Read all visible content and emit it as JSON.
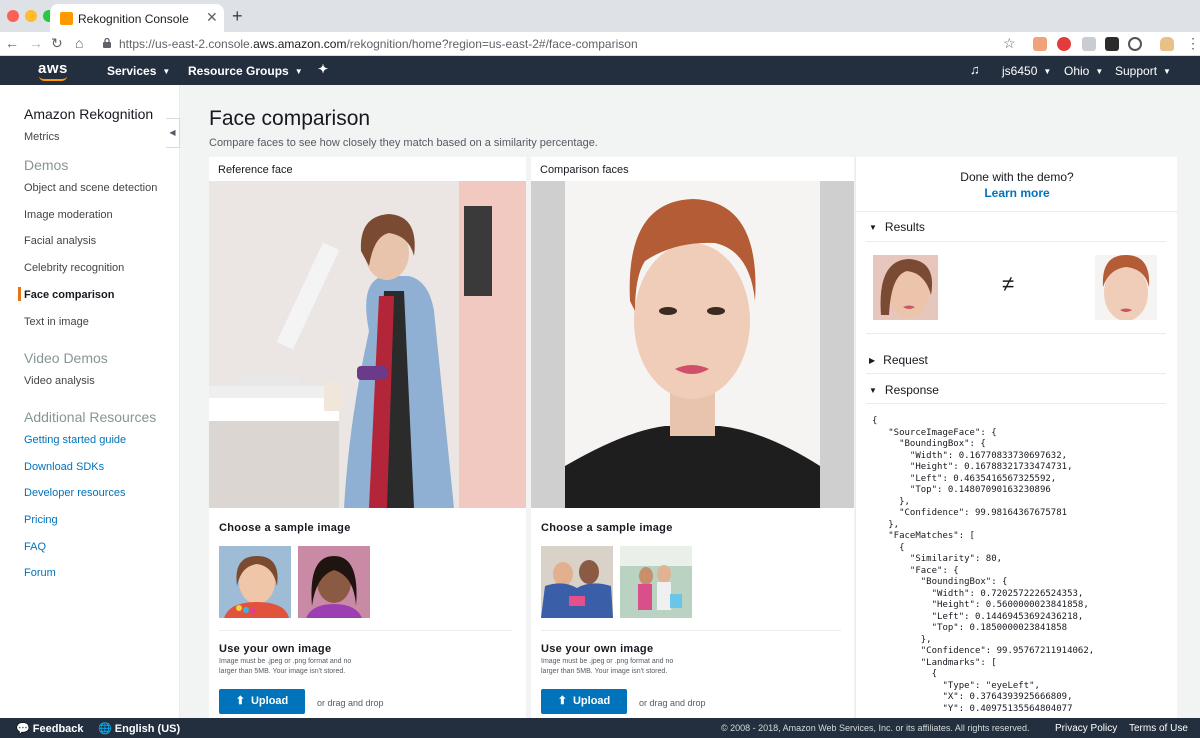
{
  "browser": {
    "tab_title": "Rekognition Console",
    "url_prefix": "https://us-east-2.console.",
    "url_domain": "aws.amazon.com",
    "url_path": "/rekognition/home?region=us-east-2#/face-comparison"
  },
  "topnav": {
    "logo": "aws",
    "services": "Services",
    "resource_groups": "Resource Groups",
    "user": "js6450",
    "region": "Ohio",
    "support": "Support"
  },
  "sidebar": {
    "title": "Amazon Rekognition",
    "metrics": "Metrics",
    "demos_heading": "Demos",
    "demos": [
      "Object and scene detection",
      "Image moderation",
      "Facial analysis",
      "Celebrity recognition",
      "Face comparison",
      "Text in image"
    ],
    "video_heading": "Video Demos",
    "video": [
      "Video analysis"
    ],
    "resources_heading": "Additional Resources",
    "resources": [
      "Getting started guide",
      "Download SDKs",
      "Developer resources",
      "Pricing",
      "FAQ",
      "Forum"
    ]
  },
  "main": {
    "title": "Face comparison",
    "subtitle": "Compare faces to see how closely they match based on a similarity percentage.",
    "reference": {
      "label": "Reference face",
      "sample_heading": "Choose a sample image",
      "own_heading": "Use your own image",
      "hint": "Image must be .jpeg or .png format and no larger than 5MB. Your image isn't stored.",
      "upload": "Upload",
      "dnd": "or drag and drop"
    },
    "comparison": {
      "label": "Comparison faces",
      "sample_heading": "Choose a sample image",
      "own_heading": "Use your own image",
      "hint": "Image must be .jpeg or .png format and no larger than 5MB. Your image isn't stored.",
      "upload": "Upload",
      "dnd": "or drag and drop"
    }
  },
  "right": {
    "done": "Done with the demo?",
    "learn_more": "Learn more",
    "results": "Results",
    "not_equal": "≠",
    "request": "Request",
    "response": "Response",
    "json": "{\n   \"SourceImageFace\": {\n     \"BoundingBox\": {\n       \"Width\": 0.16770833730697632,\n       \"Height\": 0.16788321733474731,\n       \"Left\": 0.4635416567325592,\n       \"Top\": 0.14807090163230896\n     },\n     \"Confidence\": 99.98164367675781\n   },\n   \"FaceMatches\": [\n     {\n       \"Similarity\": 80,\n       \"Face\": {\n         \"BoundingBox\": {\n           \"Width\": 0.7202572226524353,\n           \"Height\": 0.5600000023841858,\n           \"Left\": 0.14469453692436218,\n           \"Top\": 0.1850000023841858\n         },\n         \"Confidence\": 99.95767211914062,\n         \"Landmarks\": [\n           {\n             \"Type\": \"eyeLeft\",\n             \"X\": 0.3764393925666809,\n             \"Y\": 0.40975135564804077"
  },
  "footer": {
    "feedback": "Feedback",
    "language": "English (US)",
    "copyright": "© 2008 - 2018, Amazon Web Services, Inc. or its affiliates. All rights reserved.",
    "privacy": "Privacy Policy",
    "terms": "Terms of Use"
  },
  "colors": {
    "aws_nav": "#232f3e",
    "accent_orange": "#ec7211",
    "link_blue": "#0073bb"
  }
}
